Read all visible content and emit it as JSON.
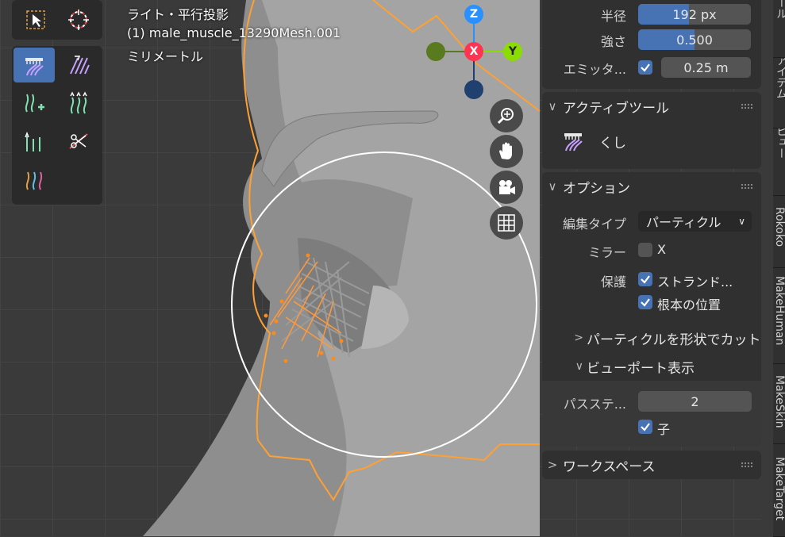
{
  "viewport": {
    "view_name": "ライト・平行投影",
    "object_name": "(1) male_muscle_13290Mesh.001",
    "units": "ミリメートル"
  },
  "toolbar": {
    "select_tool_icon": "select-box-icon",
    "cursor_tool_icon": "cursor-icon",
    "tools": [
      {
        "name": "comb-tool",
        "icon": "comb-icon",
        "active": true
      },
      {
        "name": "smooth-tool",
        "icon": "smooth-icon",
        "active": false
      },
      {
        "name": "add-tool",
        "icon": "add-hair-icon",
        "active": false
      },
      {
        "name": "length-tool",
        "icon": "length-icon",
        "active": false
      },
      {
        "name": "puff-tool",
        "icon": "puff-icon",
        "active": false
      },
      {
        "name": "cut-tool",
        "icon": "cut-icon",
        "active": false
      },
      {
        "name": "weight-tool",
        "icon": "weight-icon",
        "active": false
      }
    ]
  },
  "gizmo": {
    "z": "Z",
    "x": "X",
    "y": "Y"
  },
  "nav_buttons": [
    "zoom-icon",
    "hand-icon",
    "camera-icon",
    "grid-icon"
  ],
  "sidebar": {
    "top_fields": {
      "radius_label": "半径",
      "radius_value": "192 px",
      "radius_fill": 0.45,
      "strength_label": "強さ",
      "strength_value": "0.500",
      "strength_fill": 0.5,
      "emitter_label": "エミッタ...",
      "emitter_checked": true,
      "emitter_value": "0.25 m"
    },
    "active_tool": {
      "header": "アクティブツール",
      "tool_name": "くし",
      "icon": "comb-icon"
    },
    "options": {
      "header": "オプション",
      "edit_type_label": "編集タイプ",
      "edit_type_value": "パーティクル",
      "mirror_label": "ミラー",
      "mirror_x": "X",
      "mirror_checked": false,
      "protect_label": "保護",
      "strands_label": "ストランド...",
      "strands_checked": true,
      "root_label": "根本の位置",
      "root_checked": true,
      "cut_by_shape": "パーティクルを形状でカット",
      "viewport_display": "ビューポート表示",
      "path_steps_label": "パスステ...",
      "path_steps_value": "2",
      "children_label": "子",
      "children_checked": true
    },
    "workspace": {
      "header": "ワークスペース"
    }
  },
  "tabs": [
    "ツール",
    "アイテム",
    "ビュー",
    "Rokoko",
    "MakeHuman",
    "MakeSkin",
    "MakeTarget"
  ],
  "colors": {
    "accent": "#4772b3",
    "x_axis": "#ff3352",
    "y_axis": "#8bdc00",
    "z_axis": "#2890ff",
    "outline": "#ffa033"
  }
}
